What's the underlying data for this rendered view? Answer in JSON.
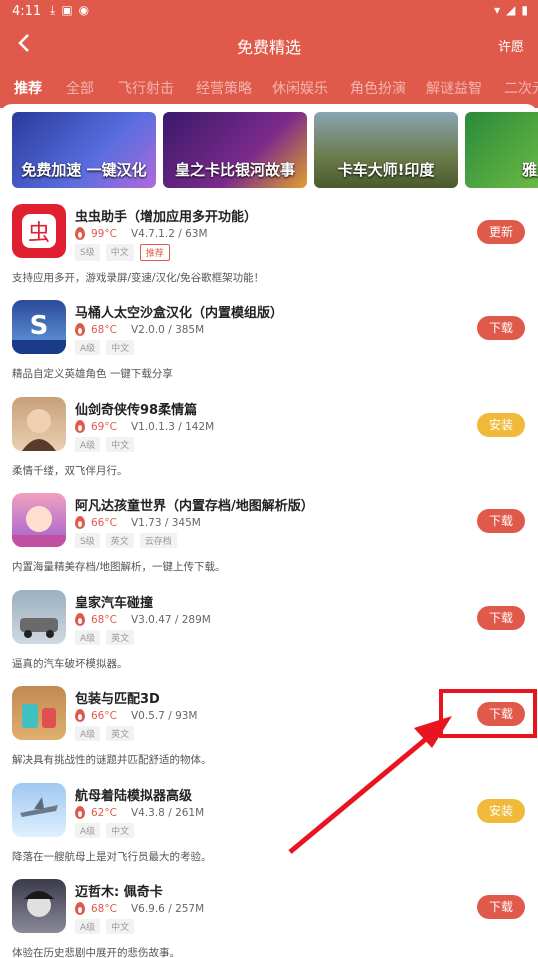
{
  "status_bar": {
    "time": "4:11",
    "left_icons": [
      "download-icon",
      "a-box-icon",
      "chongchong-icon"
    ],
    "right_icons": [
      "wifi-icon",
      "signal-icon",
      "battery-icon"
    ]
  },
  "app_bar": {
    "back_icon": "back-icon",
    "title": "免费精选",
    "wish_label": "许愿"
  },
  "tabs": [
    "推荐",
    "全部",
    "飞行射击",
    "经营策略",
    "休闲娱乐",
    "角色扮演",
    "解谜益智",
    "二次元"
  ],
  "banners": [
    "免费加速 一键汉化",
    "皇之卡比银河故事",
    "卡车大师!印度",
    "雅皮"
  ],
  "apps": [
    {
      "name": "虫虫助手（增加应用多开功能）",
      "temp": "99°C",
      "meta": "V4.7.1.2 / 63M",
      "tags": [
        "S级",
        "中文"
      ],
      "rec_tag": "推荐",
      "desc": "支持应用多开，游戏录屏/变速/汉化/免谷歌框架功能！",
      "action": "更新"
    },
    {
      "name": "马桶人太空沙盒汉化（内置模组版）",
      "temp": "68°C",
      "meta": "V2.0.0 / 385M",
      "tags": [
        "A级",
        "中文"
      ],
      "desc": "精品自定义英雄角色 一键下载分享",
      "action": "下载"
    },
    {
      "name": "仙剑奇侠传98柔情篇",
      "temp": "69°C",
      "meta": "V1.0.1.3 / 142M",
      "tags": [
        "A级",
        "中文"
      ],
      "desc": "柔情千缕，双飞伴月行。",
      "action": "安装"
    },
    {
      "name": "阿凡达孩童世界（内置存档/地图解析版）",
      "temp": "66°C",
      "meta": "V1.73 / 345M",
      "tags": [
        "S级",
        "英文",
        "云存档"
      ],
      "desc": "内置海量精美存档/地图解析，一键上传下载。",
      "action": "下载"
    },
    {
      "name": "皇家汽车碰撞",
      "temp": "68°C",
      "meta": "V3.0.47 / 289M",
      "tags": [
        "A级",
        "英文"
      ],
      "desc": "逼真的汽车破坏模拟器。",
      "action": "下载"
    },
    {
      "name": "包装与匹配3D",
      "temp": "66°C",
      "meta": "V0.5.7 / 93M",
      "tags": [
        "A级",
        "英文"
      ],
      "desc": "解决具有挑战性的谜题并匹配舒适的物体。",
      "action": "下载"
    },
    {
      "name": "航母着陆模拟器高级",
      "temp": "62°C",
      "meta": "V4.3.8 / 261M",
      "tags": [
        "A级",
        "中文"
      ],
      "desc": "降落在一艘航母上是对飞行员最大的考验。",
      "action": "安装"
    },
    {
      "name": "迈哲木: 佩奇卡",
      "temp": "68°C",
      "meta": "V6.9.6 / 257M",
      "tags": [
        "A级",
        "中文"
      ],
      "desc": "体验在历史悲剧中展开的悲伤故事。",
      "action": "下载"
    }
  ],
  "colors": {
    "brand": "#e05a4b",
    "install": "#f0b93a",
    "highlight": "#e8141f"
  }
}
